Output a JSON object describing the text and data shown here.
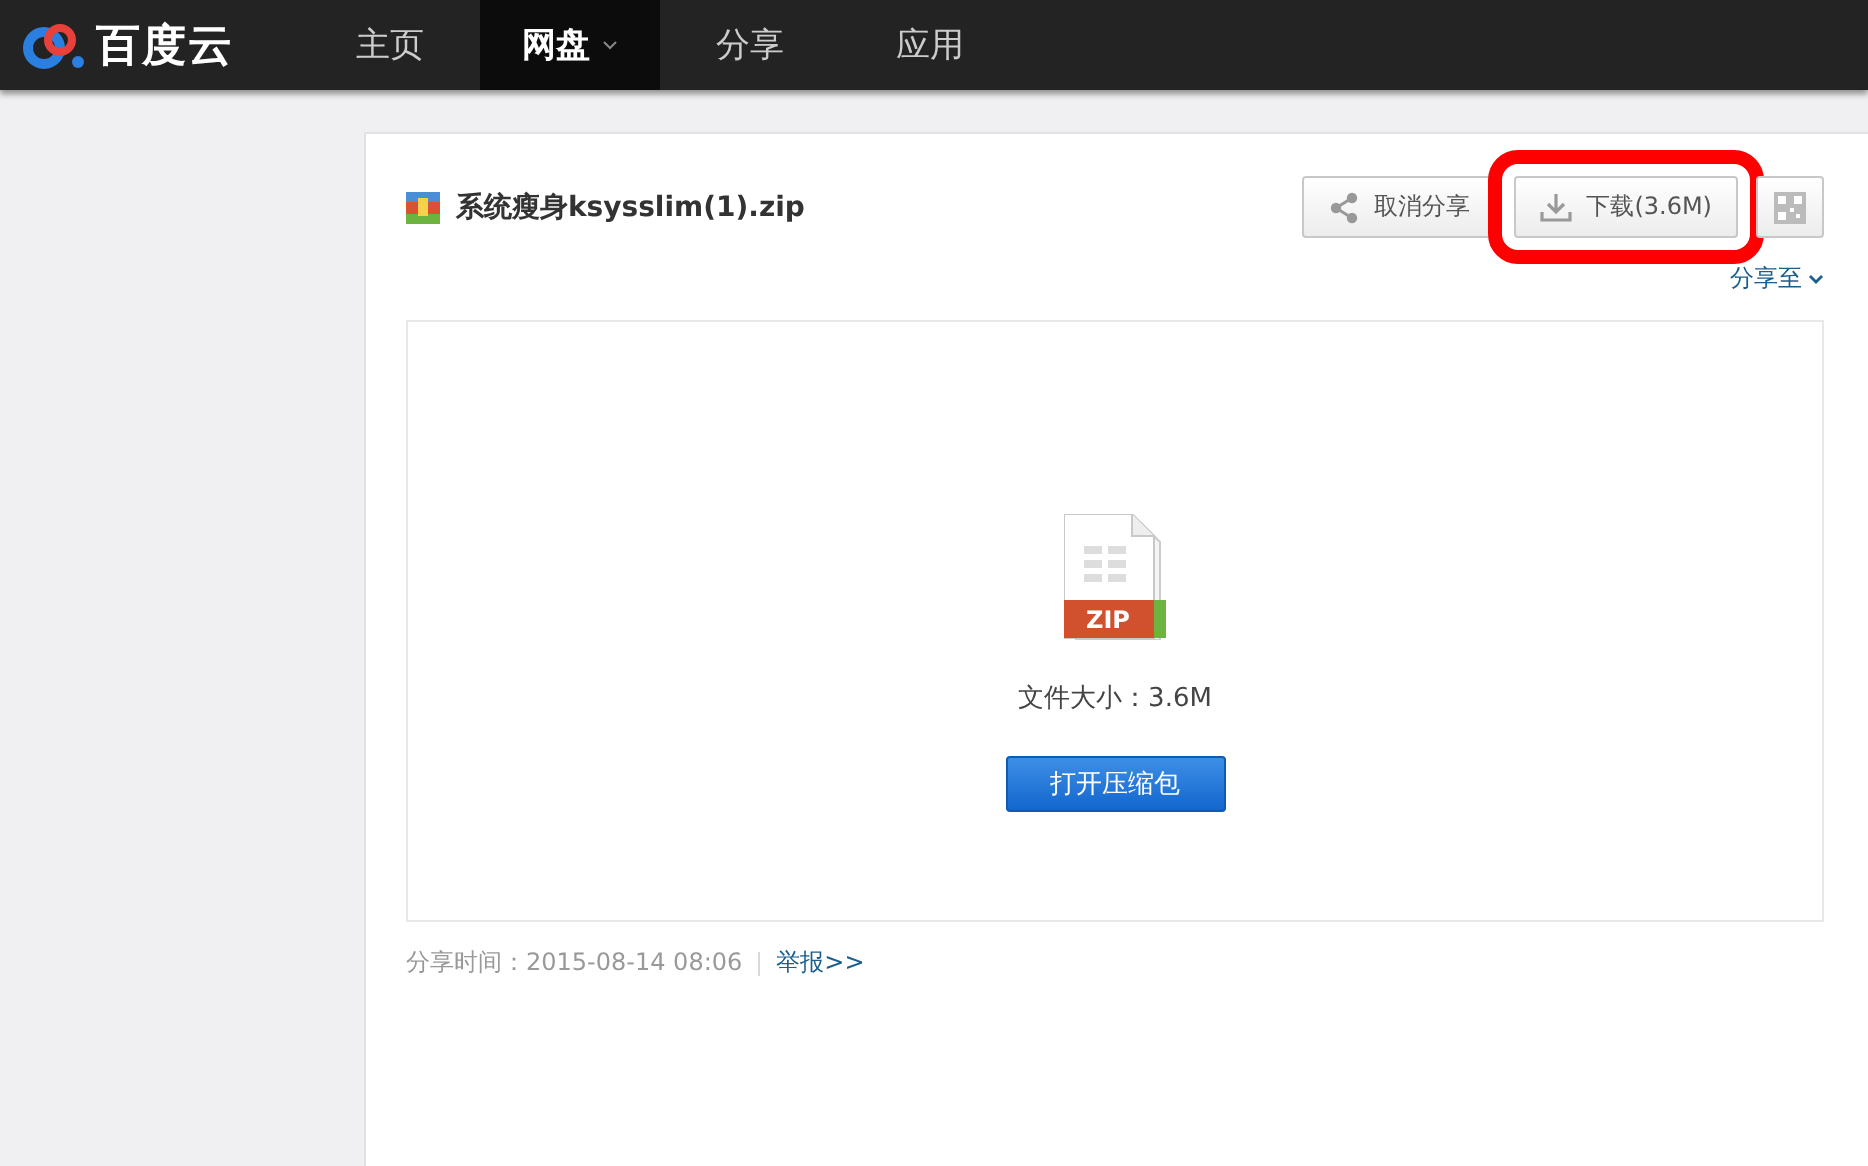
{
  "brand": {
    "name": "百度云"
  },
  "nav": [
    {
      "label": "主页",
      "selected": false,
      "dropdown": false
    },
    {
      "label": "网盘",
      "selected": true,
      "dropdown": true
    },
    {
      "label": "分享",
      "selected": false,
      "dropdown": false
    },
    {
      "label": "应用",
      "selected": false,
      "dropdown": false
    }
  ],
  "file": {
    "name": "系统瘦身ksysslim(1).zip",
    "actions": [
      {
        "kind": "share",
        "label": "取消分享",
        "highlighted": false
      },
      {
        "kind": "download",
        "label": "下载(3.6M)",
        "highlighted": true
      },
      {
        "kind": "qrcode",
        "highlighted": false
      }
    ],
    "share_to": "分享至",
    "preview": {
      "type_label": "ZIP",
      "size": "文件大小：3.6M",
      "open_button": "打开压缩包"
    },
    "footer": {
      "time": "分享时间：2015-08-14 08:06",
      "report_link": "举报>>"
    }
  }
}
